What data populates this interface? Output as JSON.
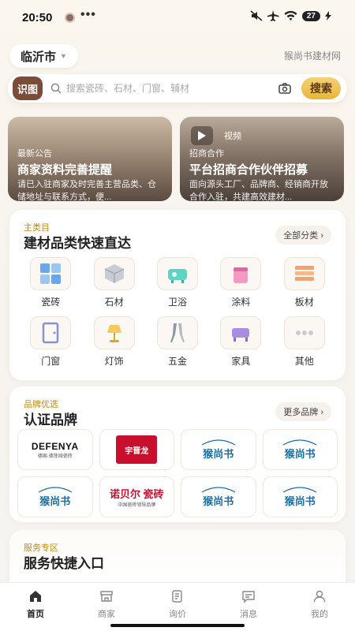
{
  "status_bar": {
    "time": "20:50",
    "dots": "•••",
    "battery": "27",
    "avatar_icon": "avatar-icon",
    "mute_icon": "mute-icon",
    "airplane_icon": "airplane-icon",
    "wifi_icon": "wifi-icon",
    "charging_icon": "charging-icon"
  },
  "header": {
    "city": "临沂市",
    "city_icon": "chevron-down-icon",
    "brand": "猴尚书建材网"
  },
  "search": {
    "scan_label": "识图",
    "placeholder": "搜索瓷砖、石材、门窗、辅材",
    "value": "",
    "button_label": "搜索",
    "icons": [
      "search-icon",
      "camera-icon"
    ]
  },
  "banners": [
    {
      "tag": "最新公告",
      "title": "商家资料完善提醒",
      "desc": "请已入驻商家及时完善主营品类、仓储地址与联系方式，便..."
    },
    {
      "tag": "招商合作",
      "title": "平台招商合作伙伴招募",
      "desc": "面向源头工厂、品牌商、经销商开放合作入驻，共建高效建材...",
      "video_label": "视频",
      "video_icon": "play-icon"
    }
  ],
  "categories": {
    "tag": "主类目",
    "title": "建材品类快速直达",
    "more": "全部分类 ›",
    "items": [
      {
        "label": "瓷砖",
        "icon": "tile-icon"
      },
      {
        "label": "石材",
        "icon": "stone-icon"
      },
      {
        "label": "卫浴",
        "icon": "bathtub-icon"
      },
      {
        "label": "涂料",
        "icon": "paint-icon"
      },
      {
        "label": "板材",
        "icon": "board-icon"
      },
      {
        "label": "门窗",
        "icon": "door-icon"
      },
      {
        "label": "灯饰",
        "icon": "lamp-icon"
      },
      {
        "label": "五金",
        "icon": "hardware-icon"
      },
      {
        "label": "家具",
        "icon": "furniture-icon"
      },
      {
        "label": "其他",
        "icon": "more-icon"
      }
    ]
  },
  "brands": {
    "tag": "品牌优选",
    "title": "认证品牌",
    "more": "更多品牌 ›",
    "logos": [
      {
        "type": "defenya",
        "text": "DEFENYA",
        "sub": "德国·德菲娅瓷砖"
      },
      {
        "type": "redbox",
        "text": "宇晋龙"
      },
      {
        "type": "hss",
        "text": "猴尚书"
      },
      {
        "type": "hss",
        "text": "猴尚书"
      },
      {
        "type": "hss",
        "text": "猴尚书"
      },
      {
        "type": "nobel",
        "text": "诺贝尔 瓷砖",
        "sub": "中国瓷砖领导品牌"
      },
      {
        "type": "hss",
        "text": "猴尚书"
      },
      {
        "type": "hss",
        "text": "猴尚书"
      }
    ]
  },
  "services": {
    "tag": "服务专区",
    "title": "服务快捷入口"
  },
  "tabbar": {
    "items": [
      {
        "label": "首页",
        "icon": "home-icon",
        "active": true
      },
      {
        "label": "商家",
        "icon": "shop-icon",
        "active": false
      },
      {
        "label": "询价",
        "icon": "inquiry-icon",
        "active": false
      },
      {
        "label": "消息",
        "icon": "message-icon",
        "active": false
      },
      {
        "label": "我的",
        "icon": "user-icon",
        "active": false
      }
    ]
  },
  "colors": {
    "accent": "#e8b53a",
    "scan_bg": "#7a4d3a",
    "section_tag": "#c48a1a",
    "brand_blue": "#1d6fa3",
    "brand_red": "#c8102e"
  }
}
